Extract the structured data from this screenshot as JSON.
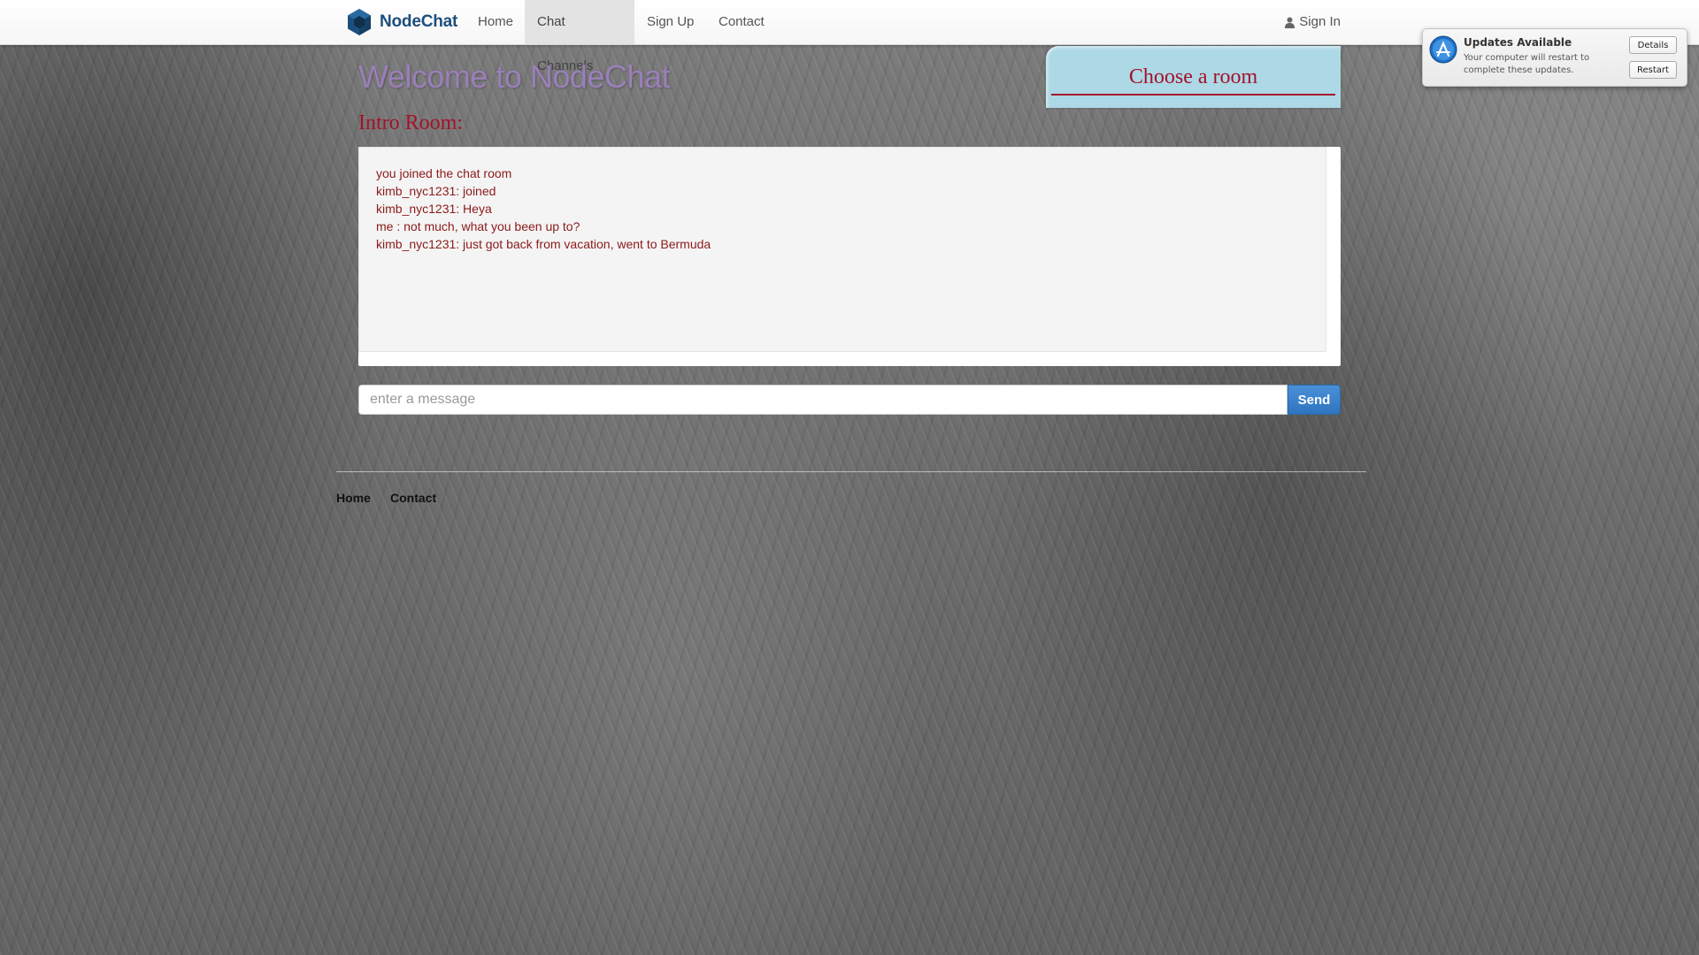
{
  "nav": {
    "brand": "NodeChat",
    "items": [
      {
        "label": "Home",
        "active": false
      },
      {
        "label": "Chat Channels",
        "active": true
      },
      {
        "label": "Sign Up",
        "active": false
      },
      {
        "label": "Contact",
        "active": false
      }
    ],
    "signin": "Sign In"
  },
  "main": {
    "welcome": "Welcome to NodeChat",
    "room_title": "Intro Room:",
    "choose_room": "Choose a room",
    "messages": [
      "you joined the chat room",
      "kimb_nyc1231: joined",
      "kimb_nyc1231: Heya",
      "me : not much, what you been up to?",
      "kimb_nyc1231: just got back from vacation, went to Bermuda"
    ],
    "input_placeholder": "enter a message",
    "send_label": "Send"
  },
  "footer": {
    "links": [
      "Home",
      "Contact"
    ]
  },
  "notification": {
    "title": "Updates Available",
    "body": "Your computer will restart to complete these updates.",
    "details_label": "Details",
    "restart_label": "Restart"
  },
  "colors": {
    "brand": "#1d4f7c",
    "accent_red": "#a3122a",
    "panel_blue": "#add8e6",
    "send_blue": "#3a7fc9"
  }
}
